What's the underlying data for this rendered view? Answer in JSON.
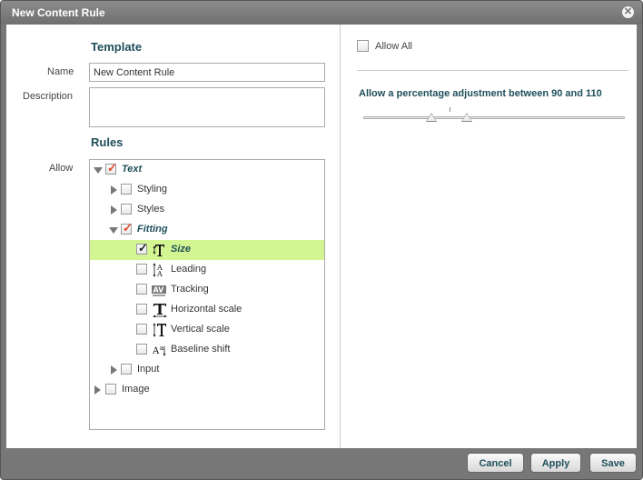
{
  "dialog": {
    "title": "New Content Rule",
    "close_glyph": "✕"
  },
  "template": {
    "heading": "Template",
    "name_label": "Name",
    "name_value": "New Content Rule",
    "description_label": "Description",
    "description_value": ""
  },
  "rules": {
    "heading": "Rules",
    "allow_label": "Allow",
    "tree": [
      {
        "label": "Text",
        "checked": true,
        "expanded": true,
        "icon": ""
      },
      {
        "label": "Styling",
        "checked": false,
        "expanded": false,
        "icon": ""
      },
      {
        "label": "Styles",
        "checked": false,
        "expanded": false,
        "icon": ""
      },
      {
        "label": "Fitting",
        "checked": true,
        "expanded": true,
        "icon": ""
      },
      {
        "label": "Size",
        "checked": true,
        "selected": true,
        "icon": "text-size-icon"
      },
      {
        "label": "Leading",
        "checked": false,
        "icon": "leading-icon"
      },
      {
        "label": "Tracking",
        "checked": false,
        "icon": "tracking-icon"
      },
      {
        "label": "Horizontal scale",
        "checked": false,
        "icon": "horizontal-scale-icon"
      },
      {
        "label": "Vertical scale",
        "checked": false,
        "icon": "vertical-scale-icon"
      },
      {
        "label": "Baseline shift",
        "checked": false,
        "icon": "baseline-shift-icon"
      },
      {
        "label": "Input",
        "checked": false,
        "expanded": false,
        "icon": ""
      },
      {
        "label": "Image",
        "checked": false,
        "expanded": false,
        "icon": ""
      }
    ]
  },
  "right_panel": {
    "allow_all_label": "Allow All",
    "allow_all_checked": false,
    "percentage_text": "Allow a percentage adjustment between 90 and 110",
    "slider": {
      "min_value": 90,
      "max_value": 110
    }
  },
  "buttons": {
    "cancel": "Cancel",
    "apply": "Apply",
    "save": "Save"
  },
  "colors": {
    "accent": "#1e4f5a",
    "selection": "#d3f592",
    "check_red": "#e4482c"
  }
}
